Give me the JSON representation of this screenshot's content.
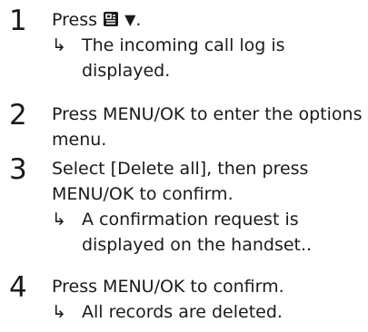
{
  "steps": [
    {
      "number": "1",
      "text_prefix": "Press ",
      "icons": [
        "call-log-icon",
        "down-arrow-icon"
      ],
      "text_suffix": ".",
      "result_arrow": "↳",
      "result": "The incoming call log is displayed."
    },
    {
      "number": "2",
      "text_prefix": "Press ",
      "key": "MENU/OK",
      "text_suffix": " to enter the options menu."
    },
    {
      "number": "3",
      "text_prefix": "Select [",
      "option": "Delete all",
      "text_middle": "], then press ",
      "key": "MENU/OK",
      "text_suffix": " to confirm.",
      "result_arrow": "↳",
      "result": "A confirmation request is displayed on the handset.."
    },
    {
      "number": "4",
      "text_prefix": "Press ",
      "key": "MENU/OK",
      "text_suffix": " to confirm.",
      "result_arrow": "↳",
      "result": "All records are deleted."
    }
  ],
  "down_arrow_glyph": "▼"
}
